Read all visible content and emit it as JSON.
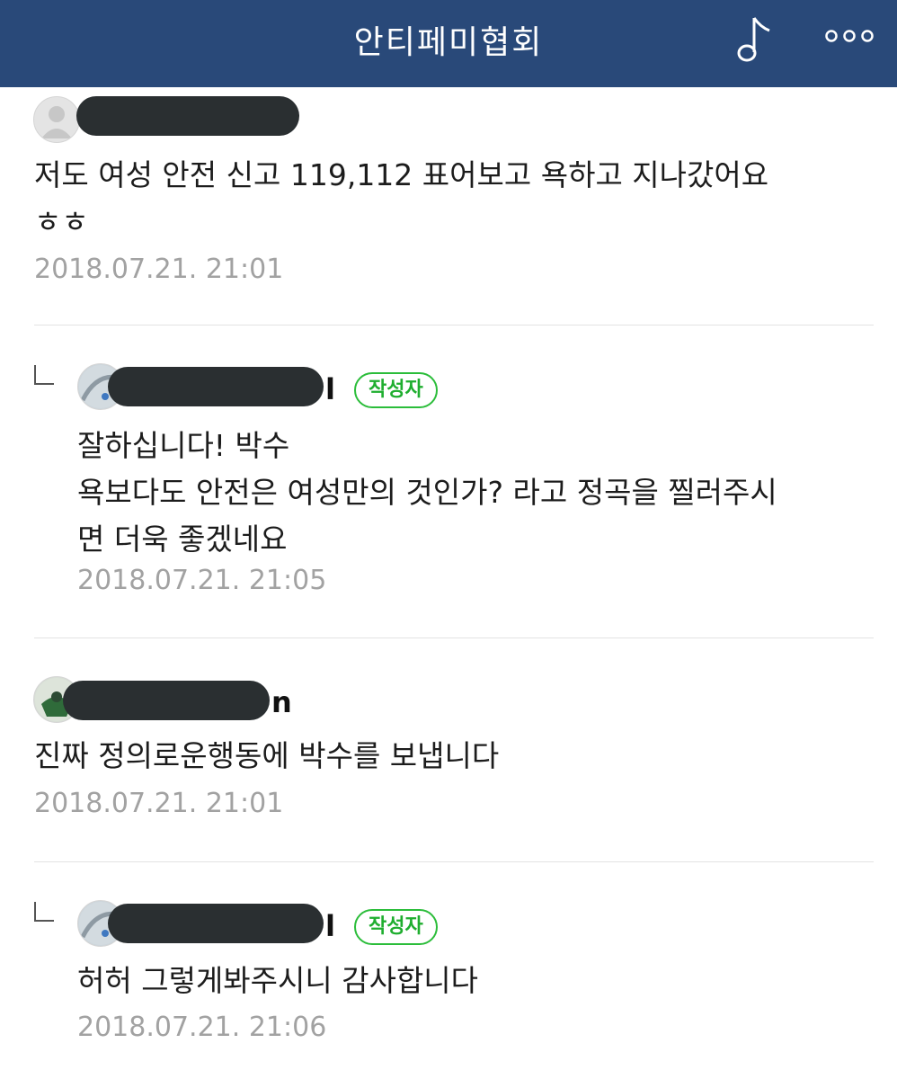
{
  "header": {
    "title": "안티페미협회",
    "note_icon": "music-note-icon",
    "more_icon": "more-dots-icon",
    "bg_color": "#294979"
  },
  "comments": [
    {
      "name_tail": "",
      "is_author": false,
      "text": "저도 여성 안전 신고 119,112 표어보고 욕하고 지나갔어요\nㅎㅎ",
      "time": "2018.07.21. 21:01"
    },
    {
      "name_tail": "l",
      "is_author": true,
      "badge": "작성자",
      "text": "잘하십니다! 박수\n욕보다도 안전은 여성만의 것인가? 라고 정곡을 찔러주시\n면 더욱 좋겠네요",
      "time": "2018.07.21. 21:05"
    },
    {
      "name_tail": "n",
      "is_author": false,
      "text": "진짜 정의로운행동에 박수를 보냅니다",
      "time": "2018.07.21. 21:01"
    },
    {
      "name_tail": "l",
      "is_author": true,
      "badge": "작성자",
      "text": "허허 그렇게봐주시니 감사합니다",
      "time": "2018.07.21. 21:06"
    }
  ],
  "colors": {
    "badge_green": "#2bbd3a",
    "timestamp_gray": "#a2a2a2"
  }
}
